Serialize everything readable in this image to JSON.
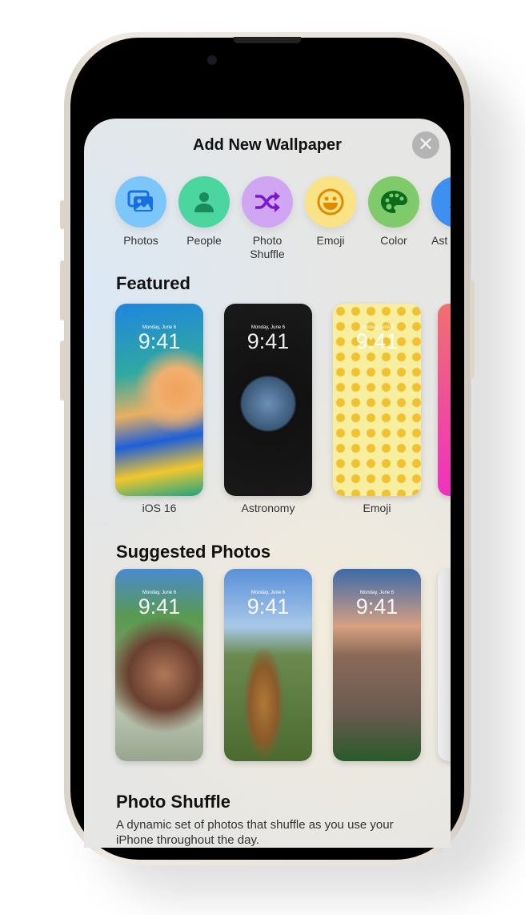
{
  "sheet": {
    "title": "Add New Wallpaper",
    "close_icon": "xmark-icon"
  },
  "categories": [
    {
      "label": "Photos",
      "color": "#7cc6f9",
      "icon": "photos-icon"
    },
    {
      "label": "People",
      "color": "#4bd59f",
      "icon": "person-icon"
    },
    {
      "label": "Photo Shuffle",
      "color": "#d0a5f2",
      "icon": "shuffle-icon"
    },
    {
      "label": "Emoji",
      "color": "#fae385",
      "icon": "smiley-icon"
    },
    {
      "label": "Color",
      "color": "#7fcb6b",
      "icon": "palette-icon"
    },
    {
      "label": "Ast",
      "color": "#3d8ff0",
      "icon": "cloud-icon"
    }
  ],
  "featured": {
    "heading": "Featured",
    "items": [
      {
        "label": "iOS 16",
        "date": "Monday, June 6",
        "time": "9:41"
      },
      {
        "label": "Astronomy",
        "date": "Monday, June 6",
        "time": "9:41"
      },
      {
        "label": "Emoji",
        "date": "Monday, June 6",
        "time": "9:41"
      }
    ]
  },
  "suggested": {
    "heading": "Suggested Photos",
    "items": [
      {
        "date": "Monday, June 6",
        "time": "9:41"
      },
      {
        "date": "Monday, June 6",
        "time": "9:41"
      },
      {
        "date": "Monday, June 6",
        "time": "9:41"
      }
    ]
  },
  "shuffle": {
    "heading": "Photo Shuffle",
    "description": "A dynamic set of photos that shuffle as you use your iPhone throughout the day."
  }
}
